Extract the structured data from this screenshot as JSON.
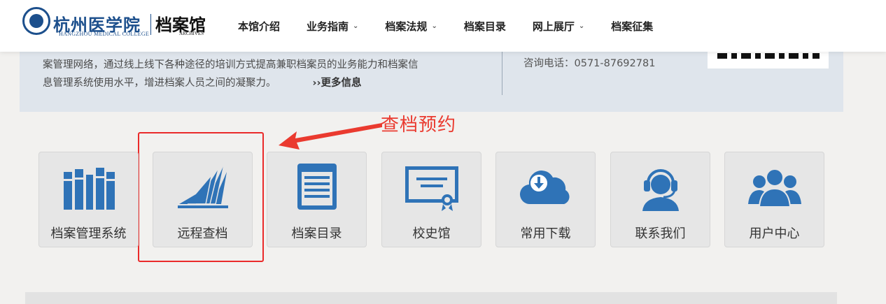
{
  "logo": {
    "name_cn": "杭州医学院",
    "name_en": "HANGZHOU MEDICAL COLLEGE",
    "archive_cn": "档案馆",
    "archive_en": "ARCHIVES"
  },
  "nav": {
    "items": [
      {
        "label": "本馆介绍",
        "dropdown": false
      },
      {
        "label": "业务指南",
        "dropdown": true
      },
      {
        "label": "档案法规",
        "dropdown": true
      },
      {
        "label": "档案目录",
        "dropdown": false
      },
      {
        "label": "网上展厅",
        "dropdown": true
      },
      {
        "label": "档案征集",
        "dropdown": false
      }
    ],
    "chevron": "⌄"
  },
  "band": {
    "line1": "案管理网络，通过线上线下各种途径的培训方式提高兼职档案员的业务能力和档案信",
    "line2": "息管理系统使用水平，增进档案人员之间的凝聚力。",
    "more": "››更多信息",
    "phone": "咨询电话：0571-87692781"
  },
  "annotation": {
    "label": "查档预约",
    "color": "#ea3a2f"
  },
  "tiles": [
    {
      "label": "档案管理系统",
      "icon": "bookshelf-icon"
    },
    {
      "label": "远程查档",
      "icon": "open-book-icon"
    },
    {
      "label": "档案目录",
      "icon": "document-list-icon"
    },
    {
      "label": "校史馆",
      "icon": "certificate-icon"
    },
    {
      "label": "常用下载",
      "icon": "cloud-download-icon"
    },
    {
      "label": "联系我们",
      "icon": "headset-user-icon"
    },
    {
      "label": "用户中心",
      "icon": "user-group-icon"
    }
  ],
  "colors": {
    "icon_blue": "#2f73b7",
    "header_bg": "#ffffff",
    "band_bg": "#dfe5ec",
    "tile_bg": "#e6e6e6"
  }
}
